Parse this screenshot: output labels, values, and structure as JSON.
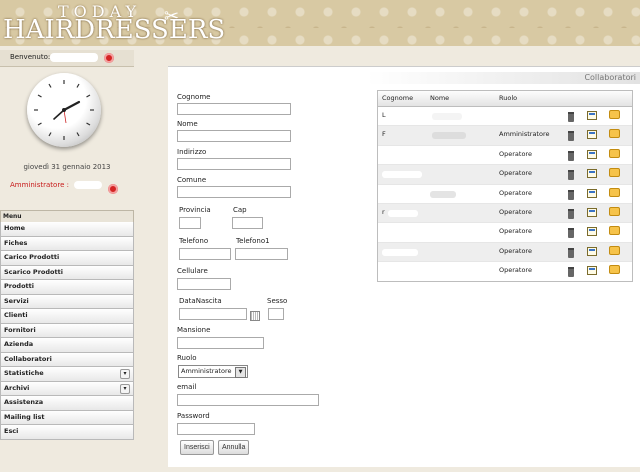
{
  "brand": {
    "top": "TODAY",
    "main": "HAIRDRESSERS"
  },
  "welcome": {
    "label": "Benvenuto:"
  },
  "date": "giovedì 31 gennaio 2013",
  "admin_label": "Amministratore :",
  "menu": {
    "header": "Menu",
    "items": [
      {
        "label": "Home"
      },
      {
        "label": "Fiches"
      },
      {
        "label": "Carico Prodotti"
      },
      {
        "label": "Scarico Prodotti"
      },
      {
        "label": "Prodotti"
      },
      {
        "label": "Servizi"
      },
      {
        "label": "Clienti"
      },
      {
        "label": "Fornitori"
      },
      {
        "label": "Azienda"
      },
      {
        "label": "Collaboratori"
      },
      {
        "label": "Statistiche"
      },
      {
        "label": "Archivi"
      },
      {
        "label": "Assistenza"
      },
      {
        "label": "Mailing list"
      },
      {
        "label": "Esci"
      }
    ]
  },
  "panel_title": "Collaboratori",
  "form": {
    "cognome": "Cognome",
    "nome": "Nome",
    "indirizzo": "Indirizzo",
    "comune": "Comune",
    "provincia": "Provincia",
    "cap": "Cap",
    "telefono": "Telefono",
    "telefono1": "Telefono1",
    "cellulare": "Cellulare",
    "datanascita": "DataNascita",
    "sesso": "Sesso",
    "mansione": "Mansione",
    "ruolo": "Ruolo",
    "ruolo_selected": "Amministratore",
    "email": "email",
    "password": "Password",
    "insert_btn": "Inserisci",
    "cancel_btn": "Annulla"
  },
  "grid": {
    "headers": {
      "cognome": "Cognome",
      "nome": "Nome",
      "ruolo": "Ruolo"
    },
    "rows": [
      {
        "cognome": "L",
        "ruolo": ""
      },
      {
        "cognome": "F",
        "ruolo": "Amministratore"
      },
      {
        "cognome": "",
        "ruolo": "Operatore"
      },
      {
        "cognome": "",
        "ruolo": "Operatore"
      },
      {
        "cognome": "",
        "ruolo": "Operatore"
      },
      {
        "cognome": "r",
        "ruolo": "Operatore"
      },
      {
        "cognome": "",
        "ruolo": "Operatore"
      },
      {
        "cognome": "",
        "ruolo": "Operatore"
      },
      {
        "cognome": "",
        "ruolo": "Operatore"
      }
    ]
  },
  "colors": {
    "admin_red": "#c71c1c",
    "banner": "#d8c9a3"
  },
  "icons": {
    "row_actions": [
      "trash-icon",
      "edit-icon",
      "mail-icon"
    ]
  }
}
